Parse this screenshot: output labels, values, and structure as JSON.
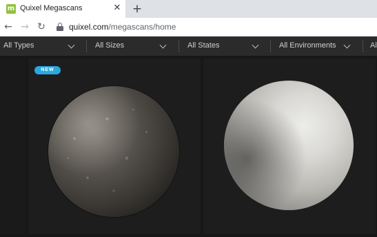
{
  "browser": {
    "tab": {
      "title": "Quixel Megascans",
      "favicon_letter": "m",
      "close_glyph": "✕"
    },
    "new_tab_glyph": "+",
    "nav": {
      "back_glyph": "←",
      "forward_glyph": "→",
      "reload_glyph": "↻"
    },
    "url": {
      "host": "quixel.com",
      "path": "/megascans/home"
    }
  },
  "filters": [
    {
      "label": "All Types"
    },
    {
      "label": "All Sizes"
    },
    {
      "label": "All States"
    },
    {
      "label": "All Environments"
    },
    {
      "label": "All"
    }
  ],
  "cards": [
    {
      "badge": "NEW",
      "material": "gravel-sphere"
    },
    {
      "material": "concrete-sphere"
    }
  ],
  "colors": {
    "badge": "#29a8e0",
    "filterbar": "#2b2b2b",
    "background": "#171717",
    "favicon": "#8fc43e"
  }
}
